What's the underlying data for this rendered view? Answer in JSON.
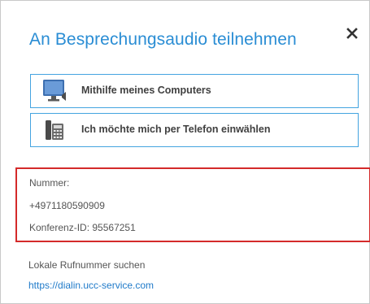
{
  "dialog": {
    "title": "An Besprechungsaudio teilnehmen",
    "close_icon": "close-icon"
  },
  "options": [
    {
      "label": "Mithilfe meines Computers",
      "icon": "computer-icon"
    },
    {
      "label": "Ich möchte mich per Telefon einwählen",
      "icon": "phone-icon"
    }
  ],
  "info": {
    "number_label": "Nummer:",
    "number": "+4971180590909",
    "conference_id": "Konferenz-ID: 95567251"
  },
  "local": {
    "label": "Lokale Rufnummer suchen",
    "link": "https://dialin.ucc-service.com"
  },
  "colors": {
    "title": "#2a8dd4",
    "option_border": "#44a4e0",
    "highlight_border": "#d42a2a",
    "link": "#1f7ac9"
  }
}
